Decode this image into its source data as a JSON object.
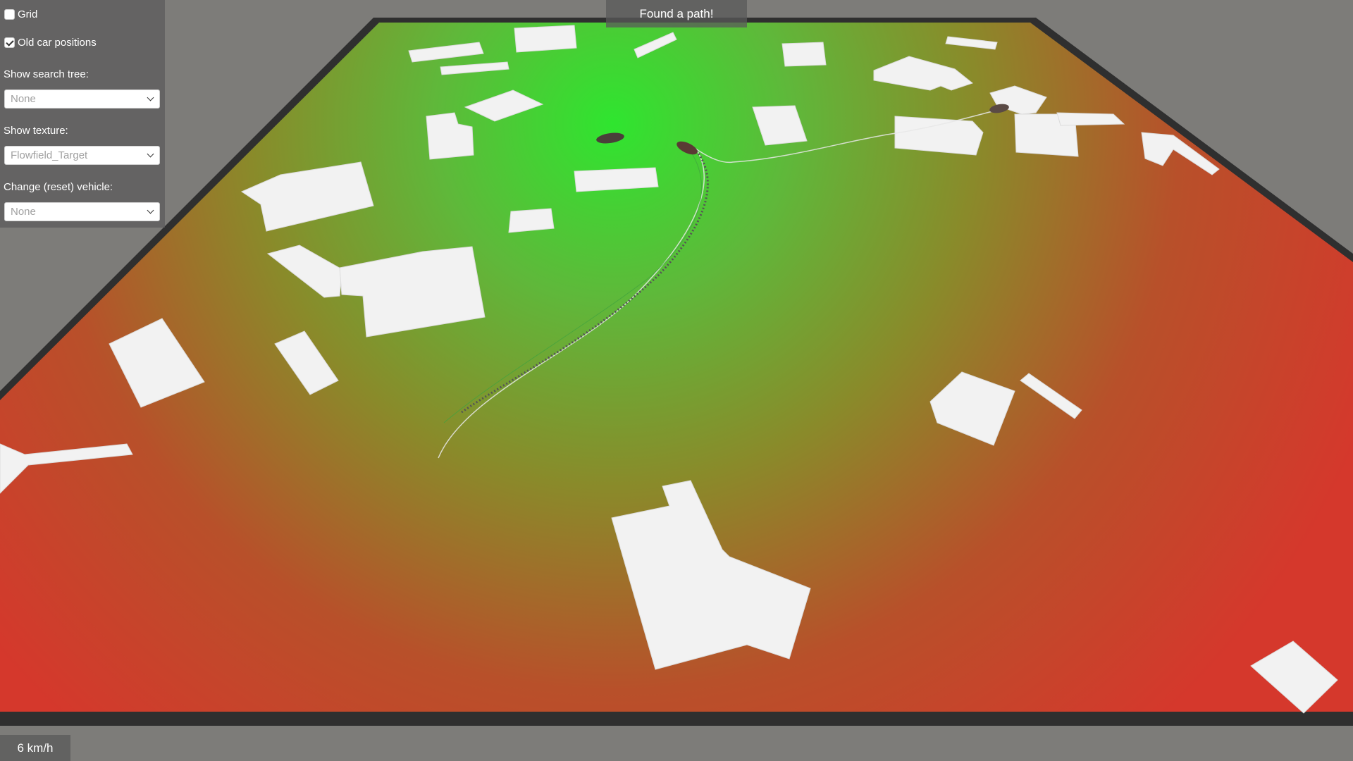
{
  "controls": {
    "grid_label": "Grid",
    "grid_checked": false,
    "old_car_label": "Old car positions",
    "old_car_checked": true,
    "search_tree_label": "Show search tree:",
    "search_tree_value": "None",
    "texture_label": "Show texture:",
    "texture_value": "Flowfield_Target",
    "vehicle_label": "Change (reset) vehicle:",
    "vehicle_value": "None"
  },
  "status": {
    "message": "Found a path!"
  },
  "hud": {
    "speed": "6 km/h"
  },
  "colors": {
    "field_near": "#33e033",
    "field_mid": "#7a8a2a",
    "field_far": "#d13a2a",
    "ground": "#7a7a78",
    "building": "#f2f2f2"
  }
}
